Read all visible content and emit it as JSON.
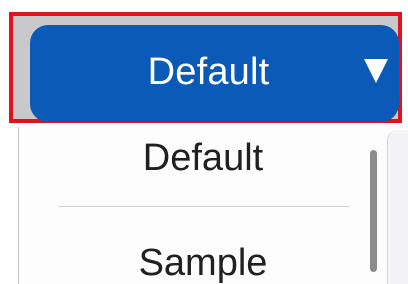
{
  "dropdown": {
    "selected_label": "Default",
    "caret_icon": "triangle-down-icon"
  },
  "menu": {
    "items": [
      {
        "label": "Default"
      },
      {
        "label": "Sample"
      }
    ]
  },
  "colors": {
    "highlight_border": "#e0121b",
    "button_background": "#0b5ab8",
    "button_text": "#ffffff"
  }
}
